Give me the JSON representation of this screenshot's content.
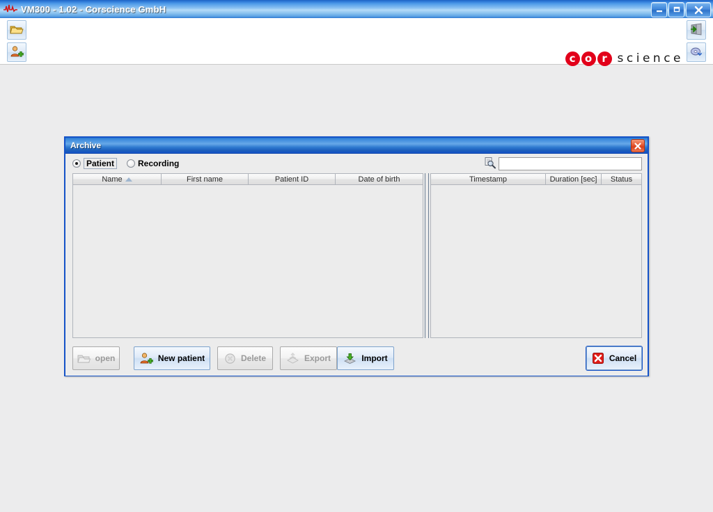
{
  "window": {
    "title": "VM300 - 1.02 - Corscience GmbH",
    "icon": "ecg-waveform-icon",
    "controls": {
      "minimize": "minimize-button",
      "maximize": "maximize-button",
      "close": "close-button"
    }
  },
  "toolbar": {
    "left_buttons": [
      {
        "name": "archive-folder-button",
        "icon": "folder-archive-icon"
      },
      {
        "name": "new-patient-button",
        "icon": "person-add-icon"
      }
    ],
    "right_buttons": [
      {
        "name": "login-button",
        "icon": "door-enter-icon"
      },
      {
        "name": "settings-button",
        "icon": "settings-disk-icon"
      }
    ]
  },
  "logo": {
    "dots": [
      "c",
      "o",
      "r"
    ],
    "word": "science",
    "accent_color": "#e2001a"
  },
  "dialog": {
    "title": "Archive",
    "close_label": "✕",
    "filter": {
      "patient_label": "Patient",
      "recording_label": "Recording",
      "selected": "Patient"
    },
    "search": {
      "icon": "document-search-icon",
      "value": "",
      "placeholder": ""
    },
    "patient_table": {
      "columns": [
        "Name",
        "First name",
        "Patient ID",
        "Date of birth"
      ],
      "sort_column": "Name",
      "sort_direction": "ascending",
      "rows": []
    },
    "recording_table": {
      "columns": [
        "Timestamp",
        "Duration [sec]",
        "Status"
      ],
      "rows": []
    },
    "buttons": [
      {
        "name": "open-button",
        "label": "open",
        "icon": "folder-open-icon",
        "enabled": false
      },
      {
        "name": "new-patient-button",
        "label": "New patient",
        "icon": "person-add-icon",
        "enabled": true
      },
      {
        "name": "delete-button",
        "label": "Delete",
        "icon": "delete-circle-icon",
        "enabled": false
      },
      {
        "name": "export-button",
        "label": "Export",
        "icon": "export-tray-icon",
        "enabled": false
      },
      {
        "name": "import-button",
        "label": "Import",
        "icon": "import-tray-icon",
        "enabled": true
      },
      {
        "name": "cancel-button",
        "label": "Cancel",
        "icon": "red-x-icon",
        "enabled": true
      }
    ]
  }
}
